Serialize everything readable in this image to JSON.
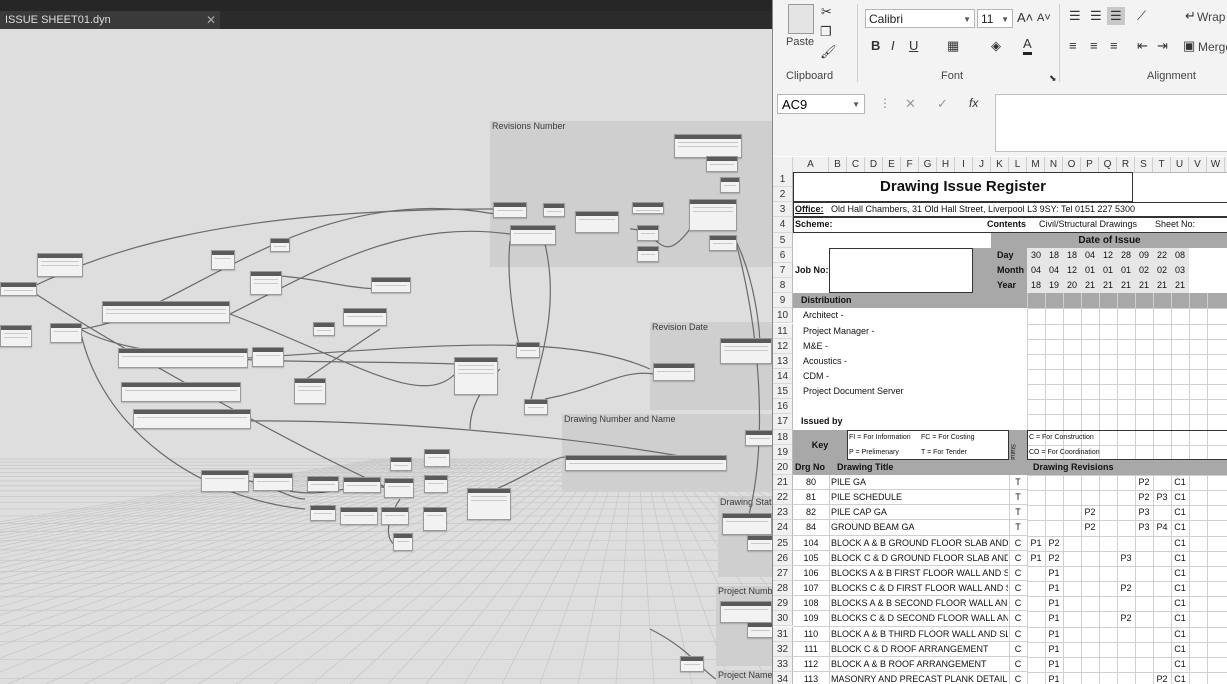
{
  "dynamo": {
    "tab_title": "ISSUE SHEET01.dyn",
    "close_glyph": "✕",
    "groups": [
      "Revisions Number",
      "Revision Date",
      "Drawing Number and Name",
      "Drawing Stat",
      "Project Numb",
      "Project Name"
    ]
  },
  "ribbon": {
    "clipboard": {
      "label": "Clipboard",
      "paste": "Paste"
    },
    "font": {
      "label": "Font",
      "family": "Calibri",
      "size": "11",
      "bold": "B",
      "italic": "I",
      "underline": "U",
      "grow": "A˄",
      "shrink": "A˅"
    },
    "alignment": {
      "label": "Alignment",
      "wrap": "Wrap",
      "merge": "Merge"
    }
  },
  "formula_bar": {
    "name_box": "AC9",
    "fx": "fx",
    "cancel": "✕",
    "enter": "✓"
  },
  "sheet": {
    "columns": [
      "A",
      "B",
      "C",
      "D",
      "E",
      "F",
      "G",
      "H",
      "I",
      "J",
      "K",
      "L",
      "M",
      "N",
      "O",
      "P",
      "Q",
      "R",
      "S",
      "T",
      "U",
      "V",
      "W"
    ],
    "rows": [
      "1",
      "2",
      "3",
      "4",
      "5",
      "6",
      "7",
      "8",
      "9",
      "10",
      "11",
      "12",
      "13",
      "14",
      "15",
      "16",
      "17",
      "18",
      "19",
      "20",
      "21",
      "22",
      "23",
      "24",
      "25",
      "26",
      "27",
      "28",
      "29",
      "30",
      "31",
      "32",
      "33",
      "34"
    ],
    "title": "Drawing Issue Register",
    "office_label": "Office:",
    "office_value": "Old Hall Chambers, 31 Old Hall Street, Liverpool L3 9SY: Tel 0151 227 5300",
    "scheme_label": "Scheme:",
    "contents_label": "Contents",
    "contents_value": "Civil/Structural Drawings",
    "sheet_no_label": "Sheet No:",
    "date_of_issue": "Date of Issue",
    "job_no": "Job No:",
    "day_label": "Day",
    "month_label": "Month",
    "year_label": "Year",
    "days": [
      "30",
      "18",
      "18",
      "04",
      "12",
      "28",
      "09",
      "22",
      "08"
    ],
    "months": [
      "04",
      "04",
      "12",
      "01",
      "01",
      "01",
      "02",
      "02",
      "03"
    ],
    "years": [
      "18",
      "19",
      "20",
      "21",
      "21",
      "21",
      "21",
      "21",
      "21"
    ],
    "distribution": "Distribution",
    "recipients": [
      "Architect -",
      "Project Manager -",
      "M&E -",
      "Acoustics -",
      "CDM -",
      "Project Document Server"
    ],
    "issued_by": "Issued by",
    "key": "Key",
    "status": "Status",
    "key_items": [
      "FI = For Information",
      "FC = For Costing",
      "C = For Construction",
      "P = Prelimenary",
      "T = For Tender",
      "CO = For Coordination"
    ],
    "drg_no": "Drg No",
    "drawing_title": "Drawing Title",
    "drawing_revisions": "Drawing Revisions",
    "drawings": [
      {
        "no": "80",
        "title": "PILE GA",
        "status": "T",
        "revs": [
          "",
          "",
          "",
          "",
          "",
          "",
          "P2",
          "",
          "C1"
        ]
      },
      {
        "no": "81",
        "title": "PILE SCHEDULE",
        "status": "T",
        "revs": [
          "",
          "",
          "",
          "",
          "",
          "",
          "P2",
          "P3",
          "C1"
        ]
      },
      {
        "no": "82",
        "title": "PILE CAP GA",
        "status": "T",
        "revs": [
          "",
          "",
          "",
          "P2",
          "",
          "",
          "P3",
          "",
          "C1"
        ]
      },
      {
        "no": "84",
        "title": "GROUND BEAM GA",
        "status": "T",
        "revs": [
          "",
          "",
          "",
          "P2",
          "",
          "",
          "P3",
          "P4",
          "C1"
        ]
      },
      {
        "no": "104",
        "title": "BLOCK A & B GROUND FLOOR SLAB AND WA",
        "status": "C",
        "revs": [
          "P1",
          "P2",
          "",
          "",
          "",
          "",
          "",
          "",
          "C1"
        ]
      },
      {
        "no": "105",
        "title": "BLOCK C & D GROUND FLOOR SLAB AND WA",
        "status": "C",
        "revs": [
          "P1",
          "P2",
          "",
          "",
          "",
          "P3",
          "",
          "",
          "C1"
        ]
      },
      {
        "no": "106",
        "title": "BLOCKS A & B FIRST FLOOR WALL AND SLAB",
        "status": "C",
        "revs": [
          "",
          "P1",
          "",
          "",
          "",
          "",
          "",
          "",
          "C1"
        ]
      },
      {
        "no": "107",
        "title": "BLOCKS C & D FIRST FLOOR WALL AND SLAB",
        "status": "C",
        "revs": [
          "",
          "P1",
          "",
          "",
          "",
          "P2",
          "",
          "",
          "C1"
        ]
      },
      {
        "no": "108",
        "title": "BLOCKS A & B SECOND FLOOR WALL AND SL",
        "status": "C",
        "revs": [
          "",
          "P1",
          "",
          "",
          "",
          "",
          "",
          "",
          "C1"
        ]
      },
      {
        "no": "109",
        "title": "BLOCKS C & D SECOND FLOOR WALL AND SL",
        "status": "C",
        "revs": [
          "",
          "P1",
          "",
          "",
          "",
          "P2",
          "",
          "",
          "C1"
        ]
      },
      {
        "no": "110",
        "title": "BLOCK A & B THIRD FLOOR WALL AND SLAB",
        "status": "C",
        "revs": [
          "",
          "P1",
          "",
          "",
          "",
          "",
          "",
          "",
          "C1"
        ]
      },
      {
        "no": "111",
        "title": "BLOCK C & D ROOF ARRANGEMENT",
        "status": "C",
        "revs": [
          "",
          "P1",
          "",
          "",
          "",
          "",
          "",
          "",
          "C1"
        ]
      },
      {
        "no": "112",
        "title": "BLOCK A & B ROOF ARRANGEMENT",
        "status": "C",
        "revs": [
          "",
          "P1",
          "",
          "",
          "",
          "",
          "",
          "",
          "C1"
        ]
      },
      {
        "no": "113",
        "title": "MASONRY AND PRECAST PLANK DETAILS",
        "status": "C",
        "revs": [
          "",
          "P1",
          "",
          "",
          "",
          "",
          "",
          "P2",
          "C1"
        ]
      }
    ]
  }
}
